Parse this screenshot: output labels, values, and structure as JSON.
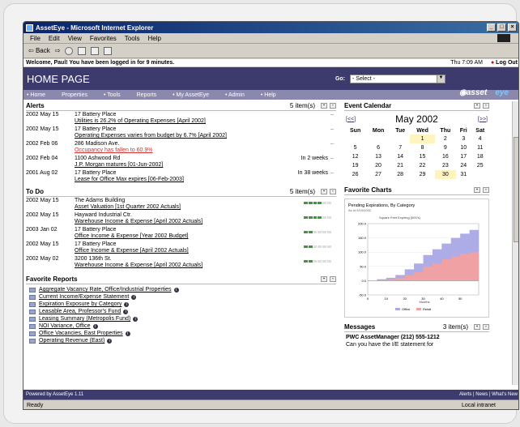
{
  "window": {
    "title": "AssetEye - Microsoft Internet Explorer"
  },
  "menu": [
    "File",
    "Edit",
    "View",
    "Favorites",
    "Tools",
    "Help"
  ],
  "toolbar": {
    "back": "Back"
  },
  "welcome": {
    "text": "Welcome, Paul! You have been logged in for 9 minutes.",
    "time": "Thu 7:09 AM",
    "logout": "Log Out"
  },
  "header": {
    "title": "HOME PAGE",
    "go_label": "Go:",
    "select": "- Select -"
  },
  "nav": [
    "Home",
    "Properties",
    "Tools",
    "Reports",
    "My AssetEye",
    "Admin",
    "Help"
  ],
  "logo": {
    "a": "asset",
    "b": "eye"
  },
  "alerts": {
    "title": "Alerts",
    "count": "5 item(s)",
    "items": [
      {
        "date": "2002 May 15",
        "prop": "17 Battery Place",
        "msg": "Utilities is 26.2% of Operating Expenses [April 2002]",
        "red": false,
        "due": ""
      },
      {
        "date": "2002 May 15",
        "prop": "17 Battery Place",
        "msg": "Operating Expenses varies from budget by 6.7% [April 2002]",
        "red": false,
        "due": ""
      },
      {
        "date": "2002 Feb 06",
        "prop": "286 Madison Ave.",
        "msg": "Occupancy has fallen to 60.9%",
        "red": true,
        "due": ""
      },
      {
        "date": "2002 Feb 04",
        "prop": "1100 Ashwood Rd",
        "msg": "J.P. Morgan matures [01-Jun-2002]",
        "red": false,
        "due": "In 2 weeks"
      },
      {
        "date": "2001 Aug 02",
        "prop": "17 Battery Place",
        "msg": "Lease for Office Max expires [06-Feb-2003]",
        "red": false,
        "due": "In 38 weeks"
      }
    ]
  },
  "todo": {
    "title": "To Do",
    "count": "5 item(s)",
    "items": [
      {
        "date": "2002 May 15",
        "prop": "The Adams Building",
        "msg": "Asset Valuation [1st Quarter 2002 Actuals]",
        "progress": 4
      },
      {
        "date": "2002 May 15",
        "prop": "Hayward Industrial Ctr.",
        "msg": "Warehouse Income & Expense [April 2002 Actuals]",
        "progress": 4
      },
      {
        "date": "2003 Jan 02",
        "prop": "17 Battery Place",
        "msg": "Office Income & Expense [Year 2002 Budget]",
        "progress": 2
      },
      {
        "date": "2002 May 15",
        "prop": "17 Battery Place",
        "msg": "Office Income & Expense [April 2002 Actuals]",
        "progress": 2
      },
      {
        "date": "2002 May 02",
        "prop": "3200 136th St.",
        "msg": "Warehouse Income & Expense [April 2002 Actuals]",
        "progress": 2
      }
    ]
  },
  "reports": {
    "title": "Favorite Reports",
    "items": [
      "Aggregate Vacancy Rate, Office/Industrial Properties",
      "Current Income/Expense Statement",
      "Expiration Exposure by Category",
      "Leasable Area, Professor's Fund",
      "Leasing Summary (Metropolis Fund)",
      "NOI Variance, Office",
      "Office Vacancies, East Properties",
      "Operating Revenue (East)"
    ]
  },
  "calendar": {
    "title": "Event Calendar",
    "prev": "[<<]",
    "next": "[>>]",
    "month": "May 2002",
    "days": [
      "Sun",
      "Mon",
      "Tue",
      "Wed",
      "Thu",
      "Fri",
      "Sat"
    ],
    "weeks": [
      [
        "",
        "",
        "",
        "1",
        "2",
        "3",
        "4"
      ],
      [
        "5",
        "6",
        "7",
        "8",
        "9",
        "10",
        "11"
      ],
      [
        "12",
        "13",
        "14",
        "15",
        "16",
        "17",
        "18"
      ],
      [
        "19",
        "20",
        "21",
        "22",
        "23",
        "24",
        "25"
      ],
      [
        "26",
        "27",
        "28",
        "29",
        "30",
        "31",
        ""
      ]
    ]
  },
  "charts": {
    "title": "Favorite Charts",
    "chart_title": "Pending Expirations, By Category",
    "chart_sub": "As of 5/15/2002",
    "inner_title": "Square Feet Expiring (000's)",
    "xlabel": "Months",
    "legend": [
      "Office",
      "Retail"
    ]
  },
  "chart_data": {
    "type": "area",
    "title": "Pending Expirations, By Category",
    "xlabel": "Months",
    "ylabel": "Square Feet Expiring (000's)",
    "ylim": [
      -50,
      200
    ],
    "x": [
      0,
      5,
      10,
      15,
      20,
      25,
      30,
      35,
      40,
      45,
      50,
      55,
      60
    ],
    "series": [
      {
        "name": "Office",
        "values": [
          0,
          5,
          10,
          20,
          40,
          60,
          90,
          110,
          130,
          150,
          165,
          178,
          185
        ]
      },
      {
        "name": "Retail",
        "values": [
          0,
          2,
          5,
          10,
          20,
          30,
          50,
          60,
          75,
          85,
          95,
          100,
          105
        ]
      }
    ],
    "x_ticks": [
      "0",
      "10",
      "20",
      "30",
      "40",
      "50"
    ],
    "y_ticks": [
      "200.0",
      "150.0",
      "100.0",
      "50.0",
      "0.0",
      "-50.0"
    ],
    "colors": {
      "Office": "#a9a8e6",
      "Retail": "#f2a0a0"
    }
  },
  "messages": {
    "title": "Messages",
    "count": "3 item(s)",
    "from": "PWC AssetManager (212) 555-1212",
    "body": "Can you have the I/E statement for"
  },
  "status": {
    "left": "Powered by AssetEye 1.11",
    "right": "Alerts | News | What's New"
  },
  "statusbar": {
    "ready": "Ready",
    "zone": "Local intranet"
  }
}
